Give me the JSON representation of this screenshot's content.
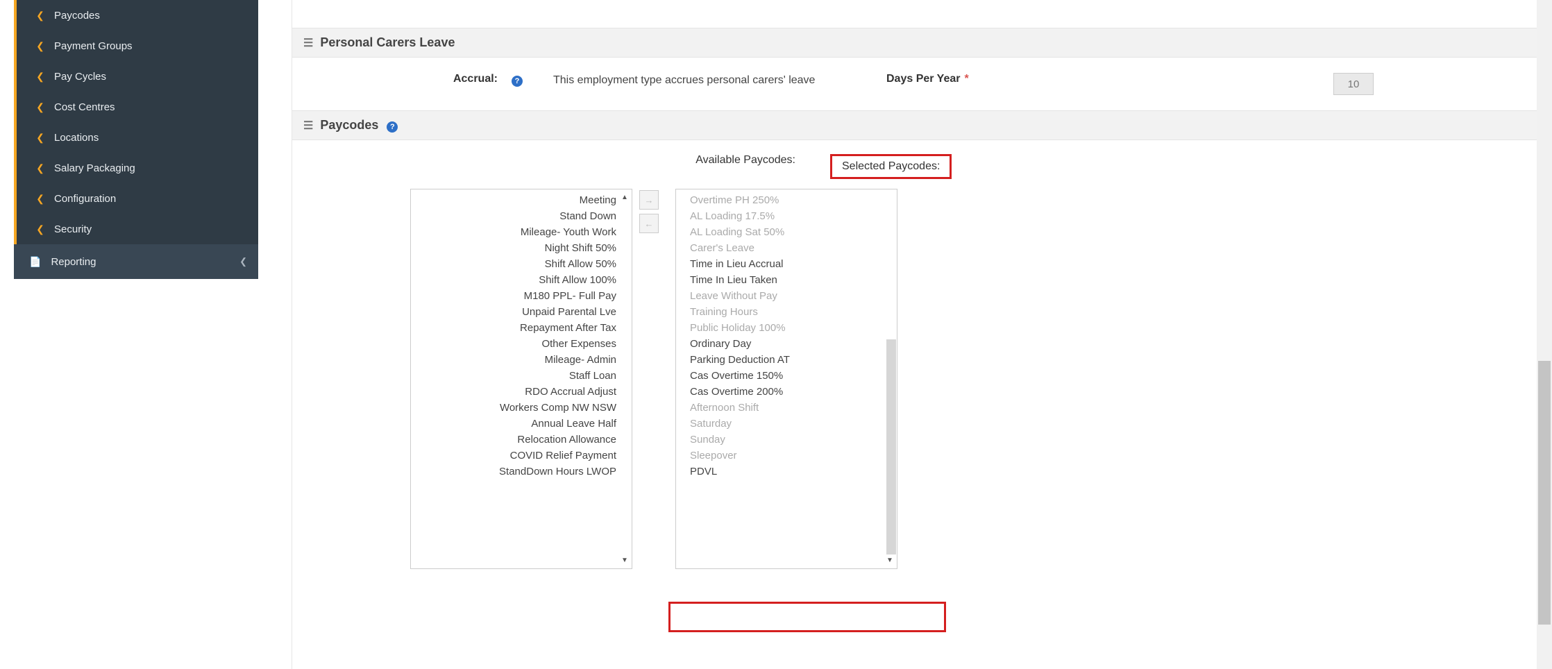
{
  "sidebar": {
    "items": [
      {
        "label": "Paycodes"
      },
      {
        "label": "Payment Groups"
      },
      {
        "label": "Pay Cycles"
      },
      {
        "label": "Cost Centres"
      },
      {
        "label": "Locations"
      },
      {
        "label": "Salary Packaging"
      },
      {
        "label": "Configuration"
      },
      {
        "label": "Security"
      }
    ],
    "reporting": "Reporting"
  },
  "sections": {
    "personal_carers": {
      "title": "Personal Carers Leave",
      "accrual_label": "Accrual:",
      "accrual_desc": "This employment type accrues personal carers' leave",
      "days_label": "Days Per Year",
      "days_value": "10"
    },
    "paycodes": {
      "title": "Paycodes",
      "available_label": "Available Paycodes:",
      "selected_label": "Selected Paycodes:"
    }
  },
  "available_paycodes": [
    "Meeting",
    "Stand Down",
    "Mileage- Youth Work",
    "Night Shift 50%",
    "Shift Allow 50%",
    "Shift Allow 100%",
    "M180 PPL- Full Pay",
    "Unpaid Parental Lve",
    "Repayment After Tax",
    "Other Expenses",
    "Mileage- Admin",
    "Staff Loan",
    "RDO Accrual Adjust",
    "Workers Comp NW NSW",
    "Annual Leave Half",
    "Relocation Allowance",
    "COVID Relief Payment",
    "StandDown Hours LWOP"
  ],
  "selected_paycodes": [
    {
      "label": "Overtime PH 250%",
      "disabled": true
    },
    {
      "label": "AL Loading 17.5%",
      "disabled": true
    },
    {
      "label": "AL Loading Sat 50%",
      "disabled": true
    },
    {
      "label": "Carer's Leave",
      "disabled": true
    },
    {
      "label": "Time in Lieu Accrual",
      "disabled": false
    },
    {
      "label": "Time In Lieu Taken",
      "disabled": false
    },
    {
      "label": "Leave Without Pay",
      "disabled": true
    },
    {
      "label": "Training Hours",
      "disabled": true
    },
    {
      "label": "Public Holiday 100%",
      "disabled": true
    },
    {
      "label": "Ordinary Day",
      "disabled": false
    },
    {
      "label": "Parking Deduction AT",
      "disabled": false
    },
    {
      "label": "Cas Overtime 150%",
      "disabled": false
    },
    {
      "label": "Cas Overtime 200%",
      "disabled": false
    },
    {
      "label": "Afternoon Shift",
      "disabled": true
    },
    {
      "label": "Saturday",
      "disabled": true
    },
    {
      "label": "Sunday",
      "disabled": true
    },
    {
      "label": "Sleepover",
      "disabled": true
    },
    {
      "label": "PDVL",
      "disabled": false
    }
  ]
}
